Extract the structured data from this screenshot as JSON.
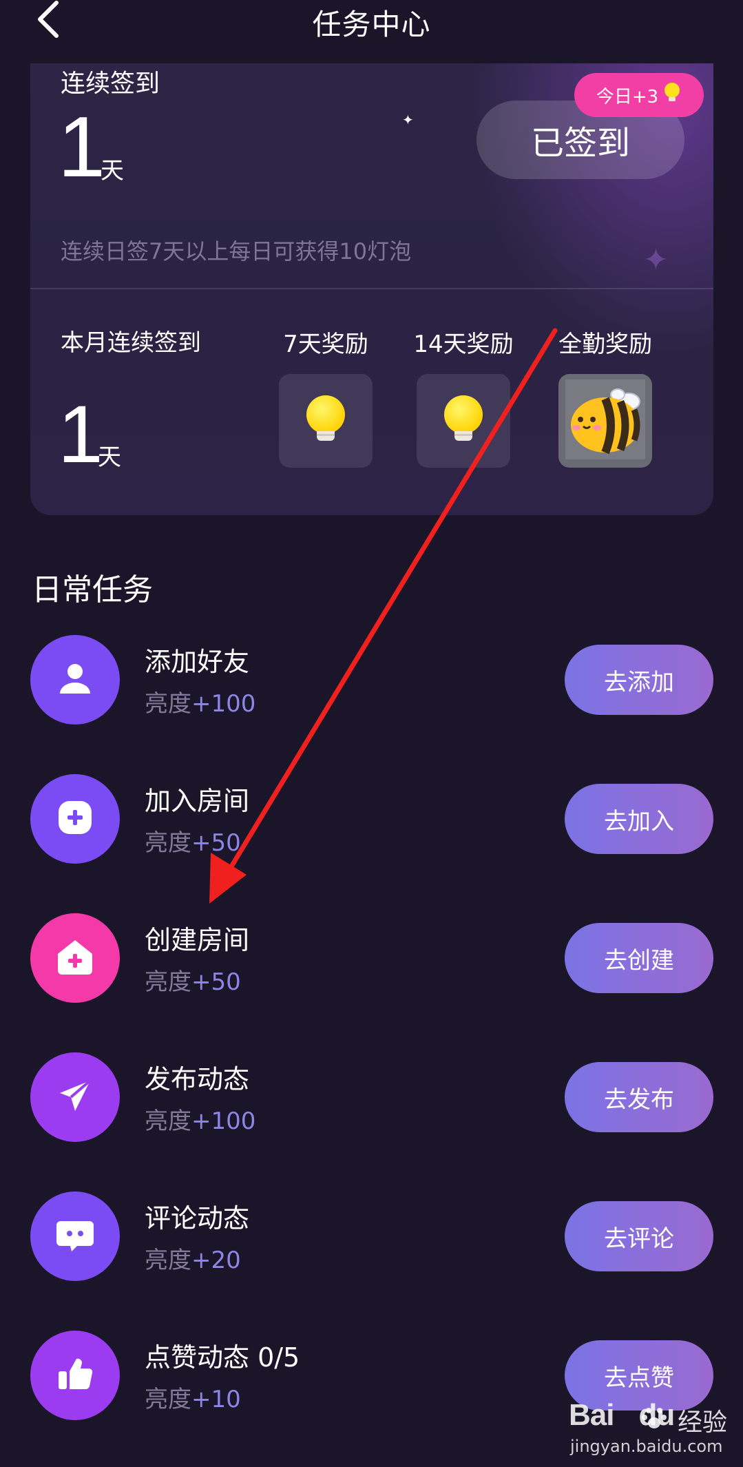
{
  "header": {
    "title": "任务中心"
  },
  "signin": {
    "streak_label": "连续签到",
    "streak_count": "1",
    "streak_unit": "天",
    "signed_button": "已签到",
    "today_badge": "今日+3",
    "tip": "连续日签7天以上每日可获得10灯泡",
    "month_label": "本月连续签到",
    "month_count": "1",
    "month_unit": "天",
    "rewards": [
      {
        "label": "7天奖励",
        "icon": "lightbulb-icon"
      },
      {
        "label": "14天奖励",
        "icon": "lightbulb-icon"
      },
      {
        "label": "全勤奖励",
        "icon": "bee-icon"
      }
    ]
  },
  "daily": {
    "title": "日常任务",
    "reward_key": "亮度",
    "tasks": [
      {
        "name": "添加好友",
        "reward": "+100",
        "button": "去添加",
        "icon": "person-icon",
        "color": "#7b4cf3"
      },
      {
        "name": "加入房间",
        "reward": "+50",
        "button": "去加入",
        "icon": "add-room-icon",
        "color": "#7b4cf3"
      },
      {
        "name": "创建房间",
        "reward": "+50",
        "button": "去创建",
        "icon": "house-plus-icon",
        "color": "#f33aa8"
      },
      {
        "name": "发布动态",
        "reward": "+100",
        "button": "去发布",
        "icon": "send-icon",
        "color": "#9b3cf0"
      },
      {
        "name": "评论动态",
        "reward": "+20",
        "button": "去评论",
        "icon": "comment-icon",
        "color": "#7b4cf3"
      },
      {
        "name": "点赞动态 0/5",
        "reward": "+10",
        "button": "去点赞",
        "icon": "thumbs-up-icon",
        "color": "#9b3cf0"
      }
    ]
  },
  "watermark": {
    "brand": "Bai",
    "brand2": "du",
    "cn": "经验",
    "url": "jingyan.baidu.com"
  },
  "colors": {
    "background": "#1a1528",
    "accent_pink": "#f23fa6",
    "accent_purple": "#7b4cf3",
    "reward_value": "#8c86e6",
    "annotation_arrow": "#f0201e"
  }
}
